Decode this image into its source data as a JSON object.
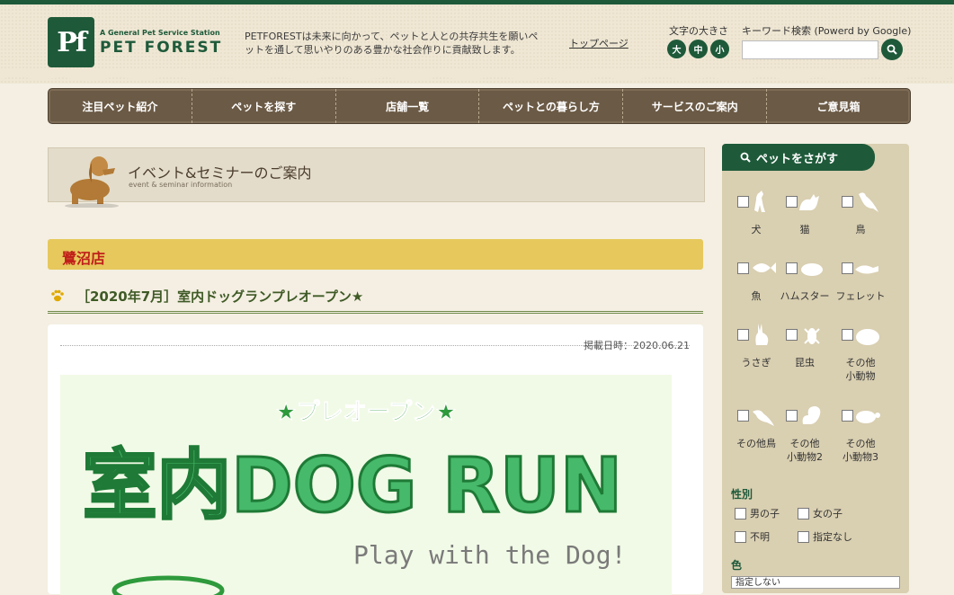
{
  "header": {
    "logo_sub": "A General Pet Service Station",
    "logo_main": "PET FOREST",
    "logo_mark": "Pf",
    "tagline": "PETFORESTは未来に向かって、ペットと人との共存共生を願いペットを通して思いやりのある豊かな社会作りに貢献致します。",
    "top_link": "トップページ",
    "font_size_label": "文字の大きさ",
    "font_sizes": [
      "大",
      "中",
      "小"
    ],
    "search_label": "キーワード検索 (Powerd by Google)",
    "search_value": ""
  },
  "nav": {
    "items": [
      "注目ペット紹介",
      "ペットを探す",
      "店舗一覧",
      "ペットとの暮らし方",
      "サービスのご案内",
      "ご意見箱"
    ]
  },
  "banner": {
    "title": "イベント&セミナーのご案内",
    "subtitle": "event & seminar information"
  },
  "store": {
    "name": "鷺沼店"
  },
  "article": {
    "title": "［2020年7月］室内ドッグランプレオープン★",
    "date": "掲載日時：2020.06.21",
    "hero": {
      "headline": "★プレオープン★",
      "main": "室内DOG RUN",
      "sub": "Play with the Dog!"
    }
  },
  "sidebar": {
    "tab": "ペットをさがす",
    "pets": [
      {
        "label": "犬",
        "icon": "dog-icon"
      },
      {
        "label": "猫",
        "icon": "cat-icon"
      },
      {
        "label": "鳥",
        "icon": "bird-icon"
      },
      {
        "label": "魚",
        "icon": "fish-icon"
      },
      {
        "label": "ハムスター",
        "icon": "hamster-icon"
      },
      {
        "label": "フェレット",
        "icon": "ferret-icon"
      },
      {
        "label": "うさぎ",
        "icon": "rabbit-icon"
      },
      {
        "label": "昆虫",
        "icon": "insect-icon"
      },
      {
        "label": "その他\n小動物",
        "icon": "small-animal-icon"
      },
      {
        "label": "その他鳥",
        "icon": "other-bird-icon"
      },
      {
        "label": "その他\n小動物2",
        "icon": "squirrel-icon"
      },
      {
        "label": "その他\n小動物3",
        "icon": "turtle-icon"
      }
    ],
    "gender_label": "性別",
    "genders": [
      "男の子",
      "女の子",
      "不明",
      "指定なし"
    ],
    "color_label": "色",
    "color_value": "指定しない"
  },
  "colors": {
    "brand_green": "#1e5a3a",
    "nav_brown": "#6b5a45",
    "store_yellow": "#e6c85c",
    "store_red": "#c0201a"
  }
}
